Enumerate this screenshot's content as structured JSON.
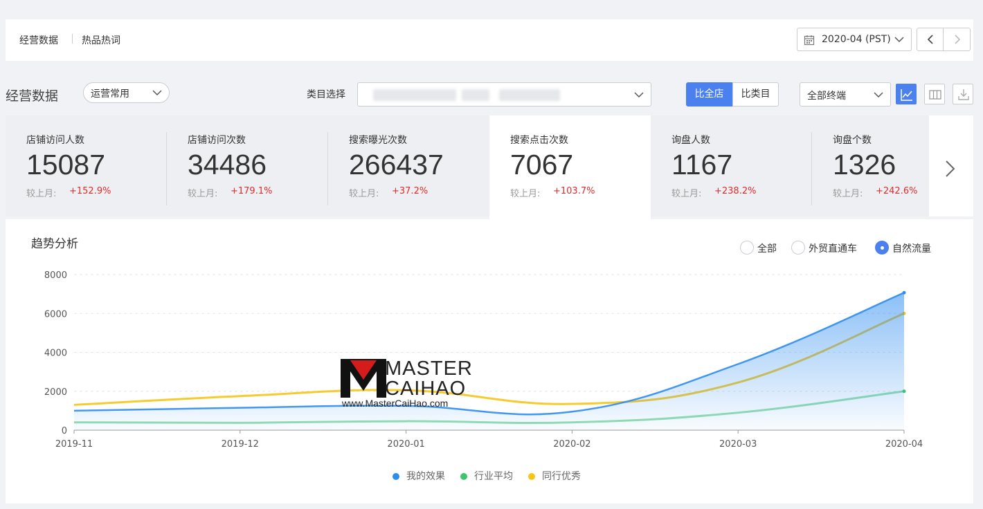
{
  "topbar": {
    "tabs": [
      "经营数据",
      "热品热词"
    ],
    "date": "2020-04 (PST)"
  },
  "header": {
    "title": "经营数据",
    "preset": "运营常用",
    "category_label": "类目选择",
    "compare": [
      "比全店",
      "比类目"
    ],
    "terminal": "全部终端"
  },
  "metrics": [
    {
      "name": "店铺访问人数",
      "value": "15087",
      "compare_label": "较上月:",
      "change": "+152.9%"
    },
    {
      "name": "店铺访问次数",
      "value": "34486",
      "compare_label": "较上月:",
      "change": "+179.1%"
    },
    {
      "name": "搜索曝光次数",
      "value": "266437",
      "compare_label": "较上月:",
      "change": "+37.2%"
    },
    {
      "name": "搜索点击次数",
      "value": "7067",
      "compare_label": "较上月:",
      "change": "+103.7%"
    },
    {
      "name": "询盘人数",
      "value": "1167",
      "compare_label": "较上月:",
      "change": "+238.2%"
    },
    {
      "name": "询盘个数",
      "value": "1326",
      "compare_label": "较上月:",
      "change": "+242.6%"
    }
  ],
  "trend": {
    "title": "趋势分析",
    "filters": [
      "全部",
      "外贸直通车",
      "自然流量"
    ],
    "selected_filter": "自然流量"
  },
  "watermark": {
    "line1": "MASTER",
    "line2": "CAIHAO",
    "url": "www.MasterCaiHao.com"
  },
  "colors": {
    "accent": "#4b80ef",
    "up": "#e02c2c",
    "mine": "#2d8cf0",
    "industry": "#3ec46d",
    "peers": "#f5c518"
  },
  "chart_data": {
    "type": "line",
    "categories": [
      "2019-11",
      "2019-12",
      "2020-01",
      "2020-02",
      "2020-03",
      "2020-04"
    ],
    "ylim": [
      0,
      8000
    ],
    "yticks": [
      "0",
      "2000",
      "4000",
      "6000",
      "8000"
    ],
    "grid": true,
    "legend_position": "bottom",
    "series": [
      {
        "name": "我的效果",
        "color": "#2d8cf0",
        "values": [
          1000,
          1150,
          1250,
          950,
          3400,
          7067
        ]
      },
      {
        "name": "行业平均",
        "color": "#3ec46d",
        "values": [
          400,
          380,
          460,
          400,
          900,
          2000
        ]
      },
      {
        "name": "同行优秀",
        "color": "#f5c518",
        "values": [
          1300,
          1750,
          2050,
          1350,
          2450,
          6000
        ]
      }
    ]
  }
}
